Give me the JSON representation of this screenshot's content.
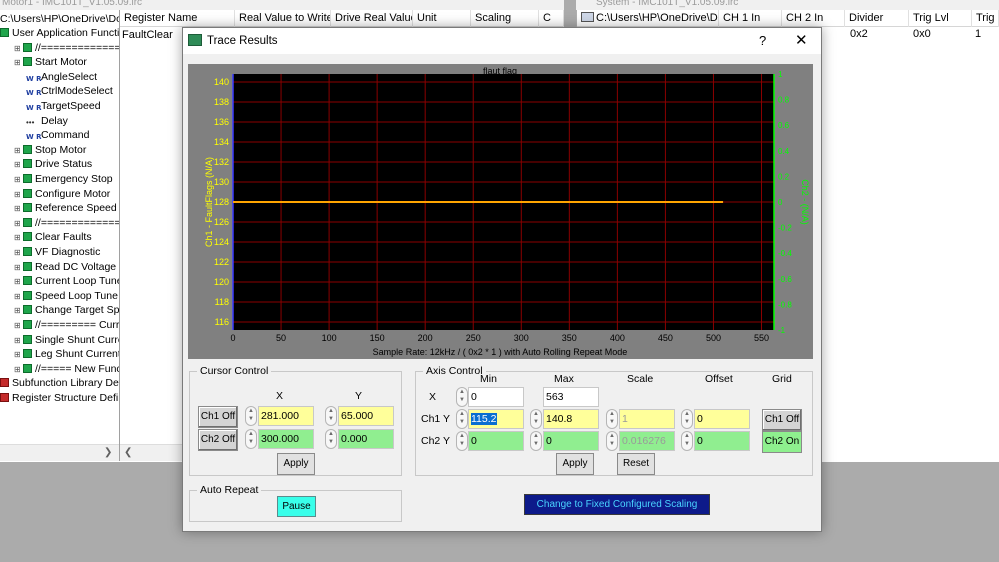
{
  "left_window": {
    "title": "Motor1 - IMC101T_V1.05.09.irc",
    "tree_root": "C:\\Users\\HP\\OneDrive\\Doc",
    "tree_items": [
      {
        "label": "User Application Functio",
        "indent": 0,
        "icon": "green-square-icon"
      },
      {
        "label": "//=============",
        "indent": 1,
        "icon": "green-square-icon"
      },
      {
        "label": "Start Motor",
        "indent": 1,
        "icon": "green-square-icon"
      },
      {
        "label": "AngleSelect",
        "indent": 2,
        "icon": "write-register-icon"
      },
      {
        "label": "CtrlModeSelect",
        "indent": 2,
        "icon": "write-register-icon"
      },
      {
        "label": "TargetSpeed",
        "indent": 2,
        "icon": "write-register-icon"
      },
      {
        "label": "Delay",
        "indent": 2,
        "icon": "delay-icon"
      },
      {
        "label": "Command",
        "indent": 2,
        "icon": "write-register-icon"
      },
      {
        "label": "Stop Motor",
        "indent": 1,
        "icon": "green-square-icon"
      },
      {
        "label": "Drive Status",
        "indent": 1,
        "icon": "green-square-icon"
      },
      {
        "label": "Emergency Stop",
        "indent": 1,
        "icon": "green-square-icon"
      },
      {
        "label": "Configure Motor",
        "indent": 1,
        "icon": "green-square-icon"
      },
      {
        "label": "Reference Speed",
        "indent": 1,
        "icon": "green-square-icon"
      },
      {
        "label": "//=============",
        "indent": 1,
        "icon": "green-square-icon"
      },
      {
        "label": "Clear Faults",
        "indent": 1,
        "icon": "green-square-icon"
      },
      {
        "label": "VF Diagnostic",
        "indent": 1,
        "icon": "green-square-icon"
      },
      {
        "label": "Read DC Voltage Co",
        "indent": 1,
        "icon": "green-square-icon"
      },
      {
        "label": "Current Loop Tune",
        "indent": 1,
        "icon": "green-square-icon"
      },
      {
        "label": "Speed Loop Tune",
        "indent": 1,
        "icon": "green-square-icon"
      },
      {
        "label": "Change Target Spee",
        "indent": 1,
        "icon": "green-square-icon"
      },
      {
        "label": "//========= Curr",
        "indent": 1,
        "icon": "green-square-icon"
      },
      {
        "label": "Single Shunt Current",
        "indent": 1,
        "icon": "green-square-icon"
      },
      {
        "label": "Leg Shunt Current Fe",
        "indent": 1,
        "icon": "green-square-icon"
      },
      {
        "label": "//===== New Funct",
        "indent": 1,
        "icon": "green-square-icon"
      },
      {
        "label": "Subfunction Library Def",
        "indent": 0,
        "icon": "red-library-icon"
      },
      {
        "label": "Register Structure Defin",
        "indent": 0,
        "icon": "red-library-icon"
      }
    ],
    "grid_headers": [
      "Register Name",
      "Real Value to Write",
      "Drive Real Value",
      "Unit",
      "Scaling",
      "C"
    ],
    "grid_rows": [
      [
        "FaultClear"
      ]
    ]
  },
  "right_window": {
    "title": "System - IMC101T_V1.05.09.irc",
    "tree_root": "C:\\Users\\HP\\OneDrive\\Doc",
    "headers": [
      "CH 1 In",
      "CH 2 In",
      "Divider",
      "Trig Lvl",
      "Trig E"
    ],
    "row": {
      "divider": "0x2",
      "trig_lvl": "0x0",
      "trig_e": "1"
    }
  },
  "dialog": {
    "title": "Trace Results",
    "help": "?",
    "close": "✕",
    "cursor_control": {
      "title": "Cursor Control",
      "x_header": "X",
      "y_header": "Y",
      "ch1_button": "Ch1 Off",
      "ch2_button": "Ch2 Off",
      "ch1_x": "281.000",
      "ch1_y": "65.000",
      "ch2_x": "300.000",
      "ch2_y": "0.000",
      "apply": "Apply"
    },
    "axis_control": {
      "title": "Axis Control",
      "headers": {
        "min": "Min",
        "max": "Max",
        "scale": "Scale",
        "offset": "Offset",
        "grid": "Grid"
      },
      "x_label": "X",
      "ch1y_label": "Ch1 Y",
      "ch2y_label": "Ch2 Y",
      "x_min": "0",
      "x_max": "563",
      "ch1_min": "115.2",
      "ch1_max": "140.8",
      "ch1_scale": "1",
      "ch1_offset": "0",
      "ch2_min": "0",
      "ch2_max": "0",
      "ch2_scale": "0.016276",
      "ch2_offset": "0",
      "grid_ch1": "Ch1 Off",
      "grid_ch2": "Ch2 On",
      "apply": "Apply",
      "reset": "Reset"
    },
    "auto_repeat": {
      "title": "Auto Repeat",
      "pause": "Pause"
    },
    "fixed_scaling_button": "Change to Fixed Configured Scaling"
  },
  "chart_data": {
    "type": "line",
    "title": "flaut flag",
    "xlabel": "Sample Rate: 12kHz / ( 0x2 * 1 ) with Auto Rolling Repeat Mode",
    "ylabel": "Ch1 - FaultFlags  (N/A)",
    "y2label": "Ch2 - (N/A)",
    "xlim": [
      0,
      563
    ],
    "ylim": [
      115.2,
      140.8
    ],
    "y2lim": [
      -1,
      1
    ],
    "x_ticks": [
      0,
      50,
      100,
      150,
      200,
      250,
      300,
      350,
      400,
      450,
      500,
      550
    ],
    "y_ticks": [
      116,
      118,
      120,
      122,
      124,
      126,
      128,
      130,
      132,
      134,
      136,
      138,
      140
    ],
    "y2_ticks": [
      "-1",
      "-0.8",
      "-0.6",
      "-0.4",
      "-0.2",
      "0",
      "0.2",
      "0.4",
      "0.6",
      "0.8",
      "1"
    ],
    "grid": true,
    "colors": {
      "plot_bg": "#000000",
      "grid": "#8b0000",
      "ch1": "#ffff00",
      "ch2": "#00ff00",
      "trace": "#ffa500",
      "frame": "#808080"
    },
    "series": [
      {
        "x": [
          0,
          510
        ],
        "y": [
          128,
          128
        ]
      }
    ]
  }
}
